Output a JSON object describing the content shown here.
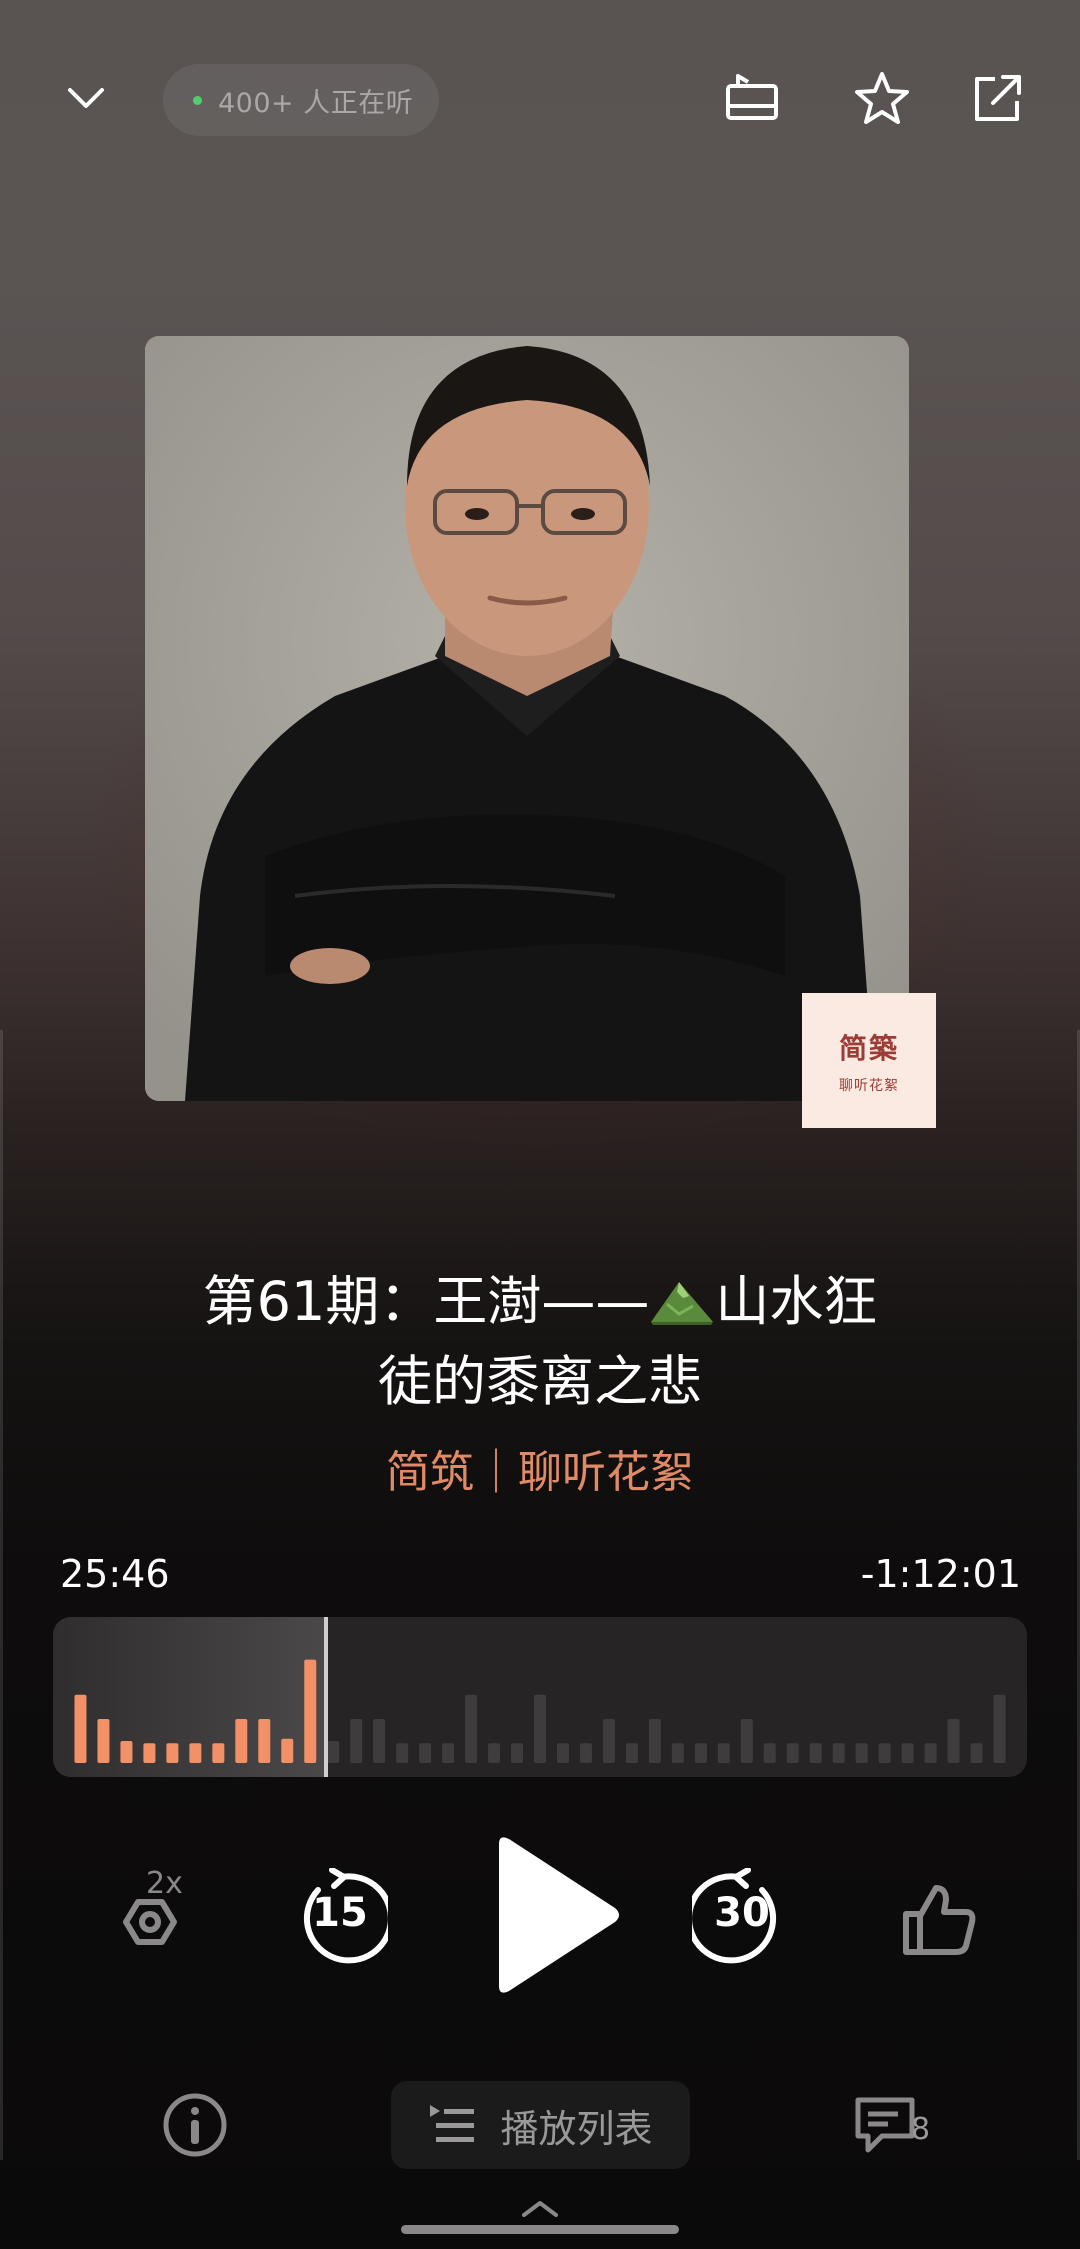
{
  "header": {
    "listeners_label": "400+ 人正在听"
  },
  "cover": {
    "badge_main": "简築",
    "badge_sub": "聊听花絮"
  },
  "episode": {
    "title_line1": "第61期：王澍——",
    "title_line1_end": "山水狂",
    "title_line2": "徒的黍离之悲",
    "show": "简筑｜聊听花絮"
  },
  "player": {
    "elapsed": "25:46",
    "remaining": "-1:12:01",
    "progress": 0.26,
    "speed_label": "2x",
    "rewind_label": "15",
    "forward_label": "30",
    "played_heights": [
      0.62,
      0.4,
      0.2,
      0.18,
      0.18,
      0.18,
      0.18,
      0.4,
      0.4,
      0.22,
      0.94
    ],
    "unplayed_heights": [
      0.2,
      0.4,
      0.4,
      0.18,
      0.18,
      0.18,
      0.62,
      0.18,
      0.18,
      0.62,
      0.18,
      0.18,
      0.4,
      0.18,
      0.4,
      0.18,
      0.18,
      0.18,
      0.4,
      0.18,
      0.18,
      0.18,
      0.18,
      0.18,
      0.18,
      0.18,
      0.18,
      0.4,
      0.18,
      0.62
    ]
  },
  "bottom": {
    "playlist_label": "播放列表",
    "comment_count": "8"
  },
  "colors": {
    "accent": "#e08a66",
    "played_bar": "#f29168",
    "unplayed_bar": "#3e3c3c",
    "listen_dot": "#4fd06a"
  },
  "icons": {
    "collapse": "chevron-down-icon",
    "tv": "screen-cast-icon",
    "favorite": "star-icon",
    "share": "share-icon",
    "speed": "speed-icon",
    "rewind": "rewind-15-icon",
    "play": "play-icon",
    "forward": "forward-30-icon",
    "like": "thumbs-up-icon",
    "info": "info-icon",
    "playlist": "playlist-icon",
    "comment": "comment-icon",
    "expand": "chevron-up-icon"
  }
}
